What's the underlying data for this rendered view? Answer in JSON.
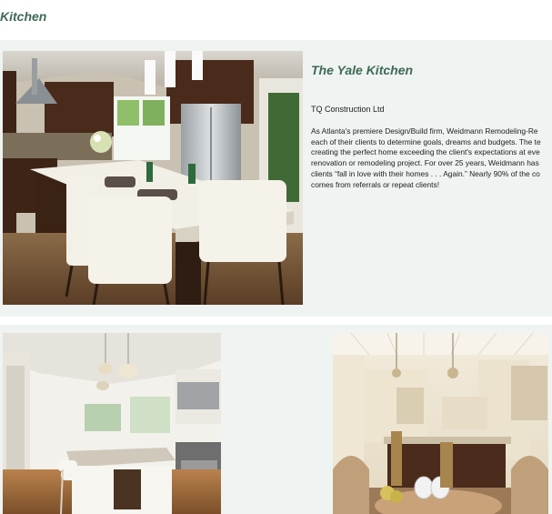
{
  "header": {
    "title": "Kitchen"
  },
  "project": {
    "title": "The Yale Kitchen",
    "company": "TQ Construction Ltd",
    "description_lines": [
      "As Atlanta's premiere Design/Build firm, Weidmann Remodeling-Re",
      "each of their clients to determine goals, dreams and budgets. The te",
      "creating the perfect home exceeding the client's expectations at eve",
      "renovation or remodeling project. For over 25 years, Weidmann has",
      "clients “fall in love with their homes . . . Again.” Nearly 90% of the co",
      "comes from referrals or repeat clients!"
    ]
  },
  "photos": [
    {
      "name": "main-kitchen-photo"
    },
    {
      "name": "white-kitchen-photo"
    },
    {
      "name": "cream-kitchen-photo"
    }
  ]
}
